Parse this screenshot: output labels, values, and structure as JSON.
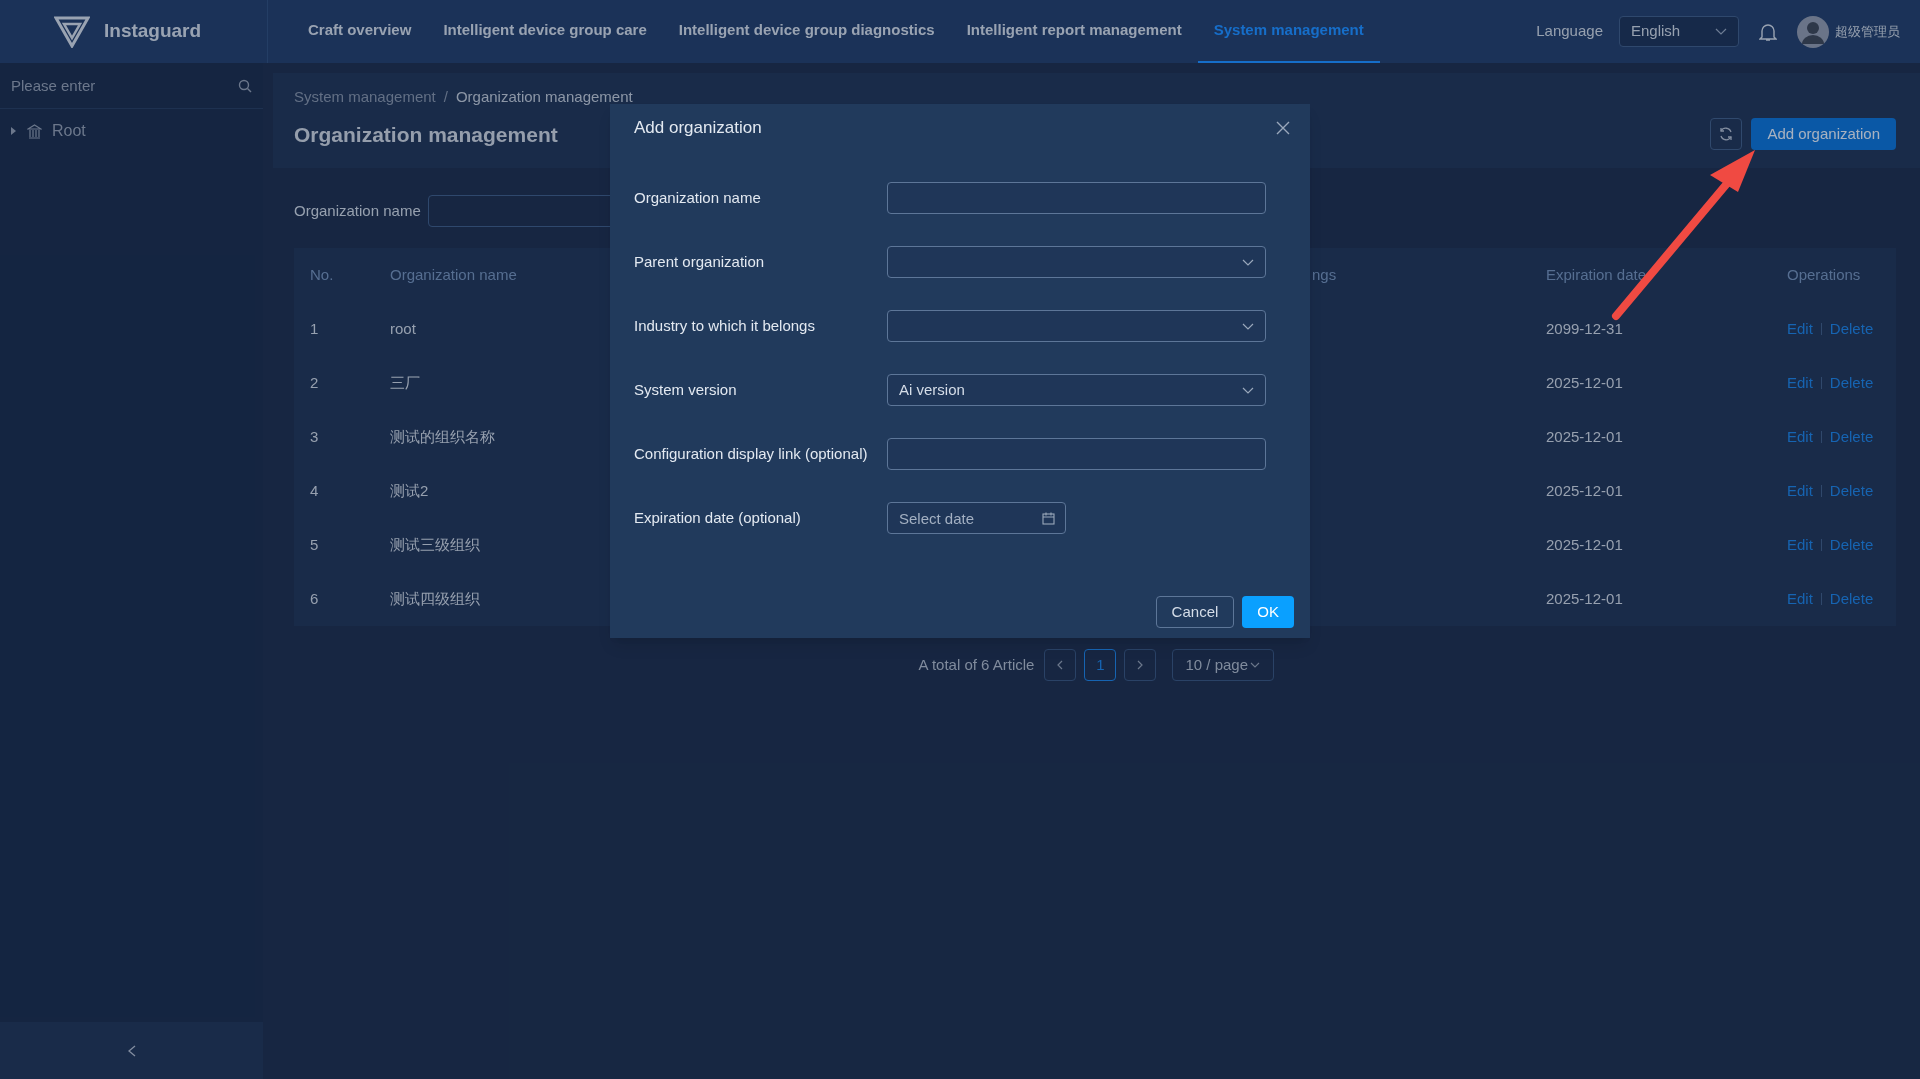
{
  "header": {
    "logo_text": "Instaguard",
    "nav": [
      {
        "label": "Craft overview",
        "selected": false
      },
      {
        "label": "Intelligent device group care",
        "selected": false
      },
      {
        "label": "Intelligent device group diagnostics",
        "selected": false
      },
      {
        "label": "Intelligent report management",
        "selected": false
      },
      {
        "label": "System management",
        "selected": true
      }
    ],
    "language_label": "Language",
    "language_value": "English",
    "user_name": "超级管理员"
  },
  "sidebar": {
    "search": {
      "placeholder": "Please enter"
    },
    "tree": [
      {
        "label": "Root",
        "expanded": false
      }
    ]
  },
  "page": {
    "breadcrumb_separator": "/",
    "breadcrumb": [
      {
        "label": "System management",
        "selected": false
      },
      {
        "label": "Organization management",
        "selected": true
      }
    ],
    "title": "Organization management",
    "add_button": "Add organization"
  },
  "filter": {
    "label": "Organization name"
  },
  "table": {
    "columns": [
      "No.",
      "Organization name",
      "ngs",
      "Expiration date",
      "Operations"
    ],
    "rows": [
      {
        "no": "1",
        "name": "root",
        "expiration": "2099-12-31",
        "actions": [
          "Edit",
          "Delete"
        ]
      },
      {
        "no": "2",
        "name": "三厂",
        "expiration": "2025-12-01",
        "actions": [
          "Edit",
          "Delete"
        ]
      },
      {
        "no": "3",
        "name": "测试的组织名称",
        "expiration": "2025-12-01",
        "actions": [
          "Edit",
          "Delete"
        ]
      },
      {
        "no": "4",
        "name": "测试2",
        "expiration": "2025-12-01",
        "actions": [
          "Edit",
          "Delete"
        ]
      },
      {
        "no": "5",
        "name": "测试三级组织",
        "expiration": "2025-12-01",
        "actions": [
          "Edit",
          "Delete"
        ]
      },
      {
        "no": "6",
        "name": "测试四级组织",
        "expiration": "2025-12-01",
        "actions": [
          "Edit",
          "Delete"
        ]
      }
    ]
  },
  "pagination": {
    "total": "A total of 6 Article",
    "pages": [
      {
        "label": "1",
        "selected": true
      }
    ],
    "page_size": "10 / page"
  },
  "modal": {
    "title": "Add organization",
    "fields": [
      {
        "label": "Organization name",
        "kind": "text"
      },
      {
        "label": "Parent organization",
        "kind": "select"
      },
      {
        "label": "Industry to which it belongs",
        "kind": "select"
      },
      {
        "label": "System version",
        "kind": "select",
        "value": "Ai version"
      },
      {
        "label": "Configuration display link (optional)",
        "kind": "text"
      },
      {
        "label": "Expiration date (optional)",
        "kind": "date",
        "placeholder": "Select date"
      }
    ],
    "buttons": [
      {
        "label": "Cancel",
        "kind": "default"
      },
      {
        "label": "OK",
        "kind": "primary"
      }
    ]
  }
}
